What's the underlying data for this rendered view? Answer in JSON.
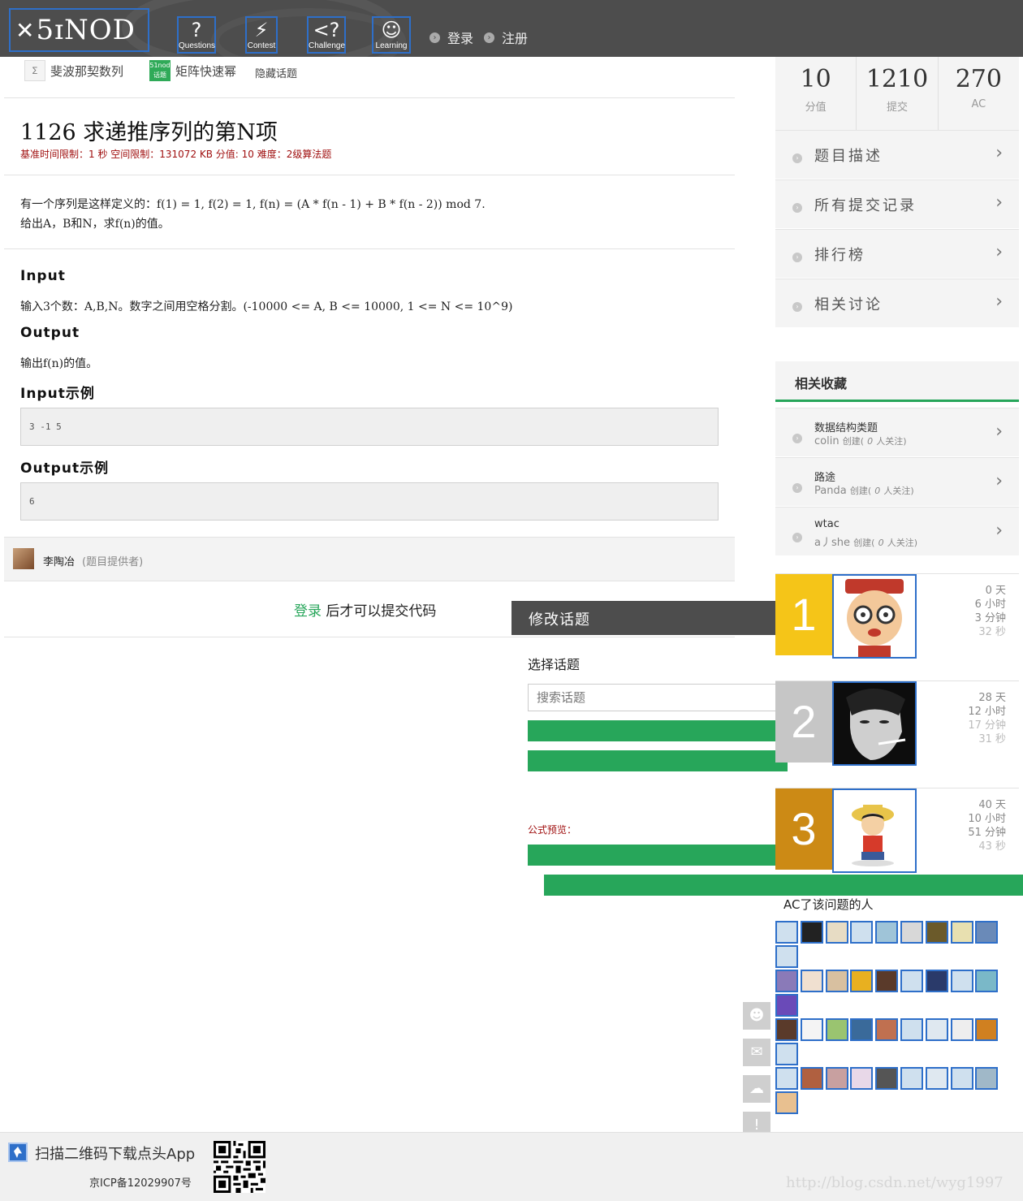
{
  "header": {
    "logo_text": "5ɪNOD",
    "nav": [
      {
        "label": "Questions",
        "icon": "question-mark-icon"
      },
      {
        "label": "Contest",
        "icon": "runner-icon"
      },
      {
        "label": "Challenge",
        "icon": "challenge-icon"
      },
      {
        "label": "Learning",
        "icon": "graduate-icon"
      }
    ],
    "login": "登录",
    "register": "注册"
  },
  "tags": [
    {
      "label": "斐波那契数列"
    },
    {
      "label": "矩阵快速幂",
      "badge": "51nod 话题"
    }
  ],
  "hide_topics": "隐藏话题",
  "problem": {
    "title": "1126 求递推序列的第N项",
    "meta": "基准时间限制：1 秒 空间限制：131072 KB 分值: 10 难度：2级算法题",
    "desc_line1": "有一个序列是这样定义的：f(1) = 1, f(2) = 1, f(n) = (A * f(n - 1) + B * f(n - 2)) mod 7.",
    "desc_line2": "给出A，B和N，求f(n)的值。",
    "input_h": "Input",
    "input_text": "输入3个数：A,B,N。数字之间用空格分割。(-10000 <= A, B <= 10000, 1 <= N <= 10^9)",
    "output_h": "Output",
    "output_text": "输出f(n)的值。",
    "input_example_h": "Input示例",
    "input_example": "3 -1 5",
    "output_example_h": "Output示例",
    "output_example": "6",
    "provider_name": "李陶冶",
    "provider_role": "(题目提供者)",
    "submit_login": "登录",
    "submit_hint": " 后才可以提交代码"
  },
  "modify": {
    "title": "修改话题",
    "choose": "选择话题",
    "search_placeholder": "搜索话题",
    "formula": "公式预览："
  },
  "stats": [
    {
      "value": "10",
      "label": "分值"
    },
    {
      "value": "1210",
      "label": "提交"
    },
    {
      "value": "270",
      "label": "AC"
    }
  ],
  "menu": [
    "题目描述",
    "所有提交记录",
    "排行榜",
    "相关讨论"
  ],
  "favorites": {
    "title": "相关收藏",
    "items": [
      {
        "name": "数据结构类题",
        "user": "colin",
        "created": "创建(",
        "count": "0",
        "follow": "人关注)"
      },
      {
        "name": "路途",
        "user": "Panda",
        "created": "创建(",
        "count": "0",
        "follow": "人关注)"
      },
      {
        "name": "wtac",
        "user": "a丿she",
        "created": "创建(",
        "count": "0",
        "follow": "人关注)"
      }
    ]
  },
  "ranks": [
    {
      "rank": "1",
      "color": "#f5c518",
      "lines": [
        "0 天",
        "6 小时",
        "3 分钟",
        "32 秒"
      ]
    },
    {
      "rank": "2",
      "color": "#c6c6c6",
      "lines": [
        "28 天",
        "12 小时",
        "17 分钟",
        "31 秒"
      ]
    },
    {
      "rank": "3",
      "color": "#cc8a15",
      "lines": [
        "40 天",
        "10 小时",
        "51 分钟",
        "43 秒"
      ]
    }
  ],
  "ac_title": "AC了该问题的人",
  "footer": {
    "app_text": "扫描二维码下载点头App",
    "icp": "京ICP备12029907号"
  },
  "watermark": "http://blog.csdn.net/wyg1997"
}
